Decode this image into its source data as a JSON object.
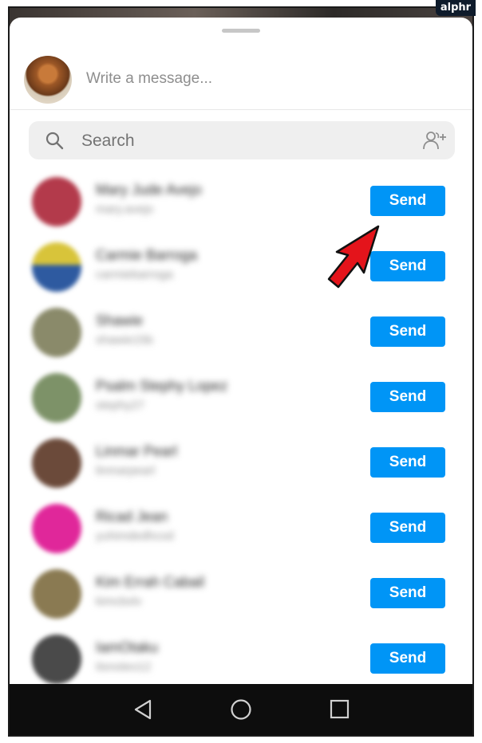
{
  "watermark": "alphr",
  "compose": {
    "placeholder": "Write a message..."
  },
  "search": {
    "placeholder": "Search"
  },
  "contacts": [
    {
      "name": "Mary Jude Avejo",
      "username": "mary.avejo",
      "send_label": "Send",
      "color": "#b33a4b"
    },
    {
      "name": "Carmie Barroga",
      "username": "carmiebarroga",
      "send_label": "Send",
      "color": "#2e5aa0"
    },
    {
      "name": "Shawie",
      "username": "shawie15b",
      "send_label": "Send",
      "color": "#8a8a6a"
    },
    {
      "name": "Psalm Stephy Lopez",
      "username": "stephy27",
      "send_label": "Send",
      "color": "#7d9268"
    },
    {
      "name": "Linmar Pearl",
      "username": "linmarpearl",
      "send_label": "Send",
      "color": "#6b4a3a"
    },
    {
      "name": "Ricad Jean",
      "username": "yuhimdedhcod",
      "send_label": "Send",
      "color": "#e0279a"
    },
    {
      "name": "Kim Errah Cabail",
      "username": "kimcbxlv",
      "send_label": "Send",
      "color": "#8a7a52"
    },
    {
      "name": "IamOtaku",
      "username": "itsnoteo12",
      "send_label": "Send",
      "color": "#4a4a4a"
    }
  ],
  "colors": {
    "accent": "#0095f6",
    "arrow": "#e4141b"
  },
  "navbar": {
    "icons": [
      "back-icon",
      "home-icon",
      "recents-icon"
    ]
  }
}
